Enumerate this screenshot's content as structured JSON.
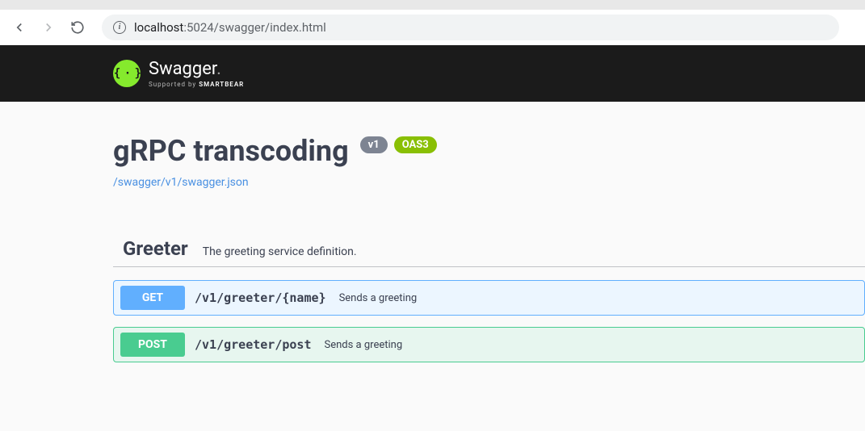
{
  "browser": {
    "url_host": "localhost",
    "url_port_path": ":5024/swagger/index.html"
  },
  "header": {
    "brand": "Swagger",
    "brand_glyph": "{ · }",
    "supported_by": "Supported by ",
    "supported_brand": "SMARTBEAR"
  },
  "api": {
    "title": "gRPC transcoding",
    "version_label": "v1",
    "oas_label": "OAS3",
    "spec_link": "/swagger/v1/swagger.json"
  },
  "tag": {
    "name": "Greeter",
    "description": "The greeting service definition."
  },
  "operations": [
    {
      "method": "GET",
      "path": "/v1/greeter/{name}",
      "summary": "Sends a greeting",
      "class": "op-get"
    },
    {
      "method": "POST",
      "path": "/v1/greeter/post",
      "summary": "Sends a greeting",
      "class": "op-post"
    }
  ]
}
